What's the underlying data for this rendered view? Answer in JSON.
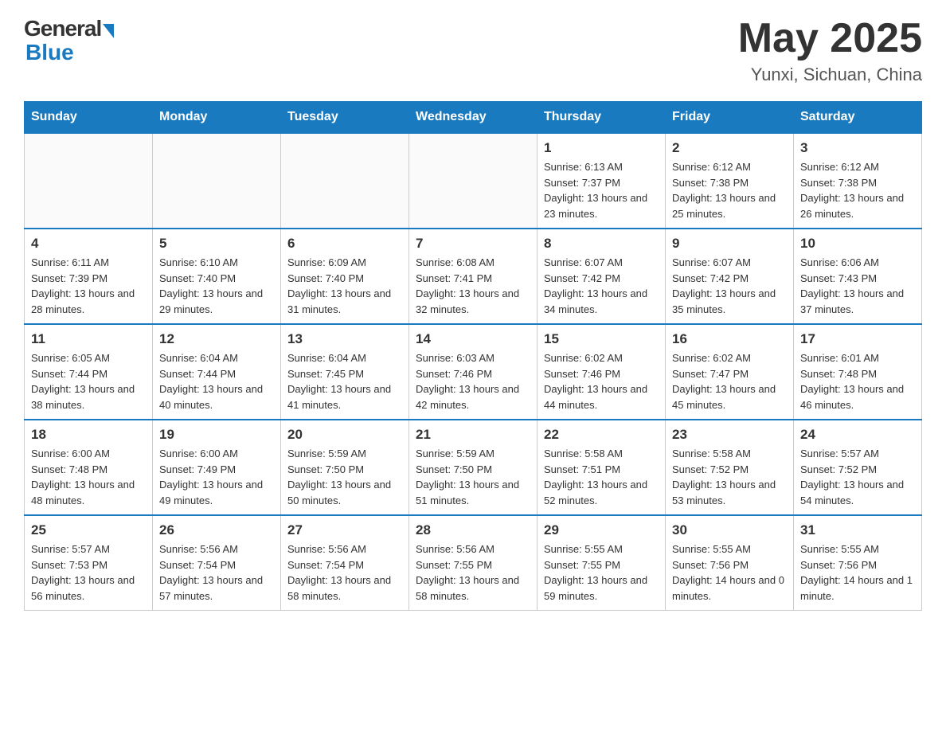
{
  "header": {
    "logo_general": "General",
    "logo_blue": "Blue",
    "title": "May 2025",
    "location": "Yunxi, Sichuan, China"
  },
  "days_of_week": [
    "Sunday",
    "Monday",
    "Tuesday",
    "Wednesday",
    "Thursday",
    "Friday",
    "Saturday"
  ],
  "weeks": [
    [
      {
        "day": "",
        "info": ""
      },
      {
        "day": "",
        "info": ""
      },
      {
        "day": "",
        "info": ""
      },
      {
        "day": "",
        "info": ""
      },
      {
        "day": "1",
        "info": "Sunrise: 6:13 AM\nSunset: 7:37 PM\nDaylight: 13 hours and 23 minutes."
      },
      {
        "day": "2",
        "info": "Sunrise: 6:12 AM\nSunset: 7:38 PM\nDaylight: 13 hours and 25 minutes."
      },
      {
        "day": "3",
        "info": "Sunrise: 6:12 AM\nSunset: 7:38 PM\nDaylight: 13 hours and 26 minutes."
      }
    ],
    [
      {
        "day": "4",
        "info": "Sunrise: 6:11 AM\nSunset: 7:39 PM\nDaylight: 13 hours and 28 minutes."
      },
      {
        "day": "5",
        "info": "Sunrise: 6:10 AM\nSunset: 7:40 PM\nDaylight: 13 hours and 29 minutes."
      },
      {
        "day": "6",
        "info": "Sunrise: 6:09 AM\nSunset: 7:40 PM\nDaylight: 13 hours and 31 minutes."
      },
      {
        "day": "7",
        "info": "Sunrise: 6:08 AM\nSunset: 7:41 PM\nDaylight: 13 hours and 32 minutes."
      },
      {
        "day": "8",
        "info": "Sunrise: 6:07 AM\nSunset: 7:42 PM\nDaylight: 13 hours and 34 minutes."
      },
      {
        "day": "9",
        "info": "Sunrise: 6:07 AM\nSunset: 7:42 PM\nDaylight: 13 hours and 35 minutes."
      },
      {
        "day": "10",
        "info": "Sunrise: 6:06 AM\nSunset: 7:43 PM\nDaylight: 13 hours and 37 minutes."
      }
    ],
    [
      {
        "day": "11",
        "info": "Sunrise: 6:05 AM\nSunset: 7:44 PM\nDaylight: 13 hours and 38 minutes."
      },
      {
        "day": "12",
        "info": "Sunrise: 6:04 AM\nSunset: 7:44 PM\nDaylight: 13 hours and 40 minutes."
      },
      {
        "day": "13",
        "info": "Sunrise: 6:04 AM\nSunset: 7:45 PM\nDaylight: 13 hours and 41 minutes."
      },
      {
        "day": "14",
        "info": "Sunrise: 6:03 AM\nSunset: 7:46 PM\nDaylight: 13 hours and 42 minutes."
      },
      {
        "day": "15",
        "info": "Sunrise: 6:02 AM\nSunset: 7:46 PM\nDaylight: 13 hours and 44 minutes."
      },
      {
        "day": "16",
        "info": "Sunrise: 6:02 AM\nSunset: 7:47 PM\nDaylight: 13 hours and 45 minutes."
      },
      {
        "day": "17",
        "info": "Sunrise: 6:01 AM\nSunset: 7:48 PM\nDaylight: 13 hours and 46 minutes."
      }
    ],
    [
      {
        "day": "18",
        "info": "Sunrise: 6:00 AM\nSunset: 7:48 PM\nDaylight: 13 hours and 48 minutes."
      },
      {
        "day": "19",
        "info": "Sunrise: 6:00 AM\nSunset: 7:49 PM\nDaylight: 13 hours and 49 minutes."
      },
      {
        "day": "20",
        "info": "Sunrise: 5:59 AM\nSunset: 7:50 PM\nDaylight: 13 hours and 50 minutes."
      },
      {
        "day": "21",
        "info": "Sunrise: 5:59 AM\nSunset: 7:50 PM\nDaylight: 13 hours and 51 minutes."
      },
      {
        "day": "22",
        "info": "Sunrise: 5:58 AM\nSunset: 7:51 PM\nDaylight: 13 hours and 52 minutes."
      },
      {
        "day": "23",
        "info": "Sunrise: 5:58 AM\nSunset: 7:52 PM\nDaylight: 13 hours and 53 minutes."
      },
      {
        "day": "24",
        "info": "Sunrise: 5:57 AM\nSunset: 7:52 PM\nDaylight: 13 hours and 54 minutes."
      }
    ],
    [
      {
        "day": "25",
        "info": "Sunrise: 5:57 AM\nSunset: 7:53 PM\nDaylight: 13 hours and 56 minutes."
      },
      {
        "day": "26",
        "info": "Sunrise: 5:56 AM\nSunset: 7:54 PM\nDaylight: 13 hours and 57 minutes."
      },
      {
        "day": "27",
        "info": "Sunrise: 5:56 AM\nSunset: 7:54 PM\nDaylight: 13 hours and 58 minutes."
      },
      {
        "day": "28",
        "info": "Sunrise: 5:56 AM\nSunset: 7:55 PM\nDaylight: 13 hours and 58 minutes."
      },
      {
        "day": "29",
        "info": "Sunrise: 5:55 AM\nSunset: 7:55 PM\nDaylight: 13 hours and 59 minutes."
      },
      {
        "day": "30",
        "info": "Sunrise: 5:55 AM\nSunset: 7:56 PM\nDaylight: 14 hours and 0 minutes."
      },
      {
        "day": "31",
        "info": "Sunrise: 5:55 AM\nSunset: 7:56 PM\nDaylight: 14 hours and 1 minute."
      }
    ]
  ]
}
